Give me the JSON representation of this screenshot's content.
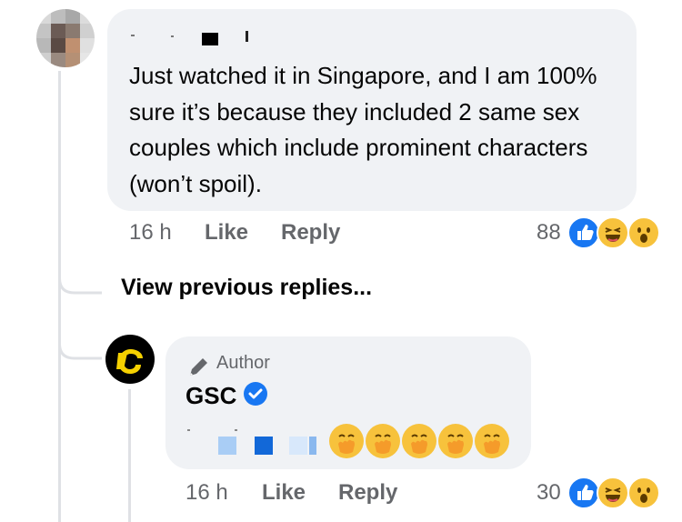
{
  "comment": {
    "text": "Just watched it in Singapore, and I am 100% sure it’s because they included 2 same sex couples which include prominent characters (won’t spoil).",
    "time": "16 h",
    "like_label": "Like",
    "reply_label": "Reply",
    "reaction_count": "88",
    "reactions": [
      "like-icon",
      "haha-icon",
      "wow-icon"
    ]
  },
  "view_previous": "View previous replies...",
  "reply": {
    "badge": "Author",
    "author_name": "GSC",
    "emojis": [
      "hand-over-mouth-emoji",
      "hand-over-mouth-emoji",
      "hand-over-mouth-emoji",
      "hand-over-mouth-emoji",
      "hand-over-mouth-emoji"
    ],
    "time": "16 h",
    "like_label": "Like",
    "reply_label": "Reply",
    "reaction_count": "30",
    "reactions": [
      "like-icon",
      "haha-icon",
      "wow-icon"
    ]
  },
  "colors": {
    "bubble_bg": "#f0f2f5",
    "meta_text": "#65676b",
    "like_blue": "#1877f2",
    "reaction_yellow": "#f7c23c"
  }
}
